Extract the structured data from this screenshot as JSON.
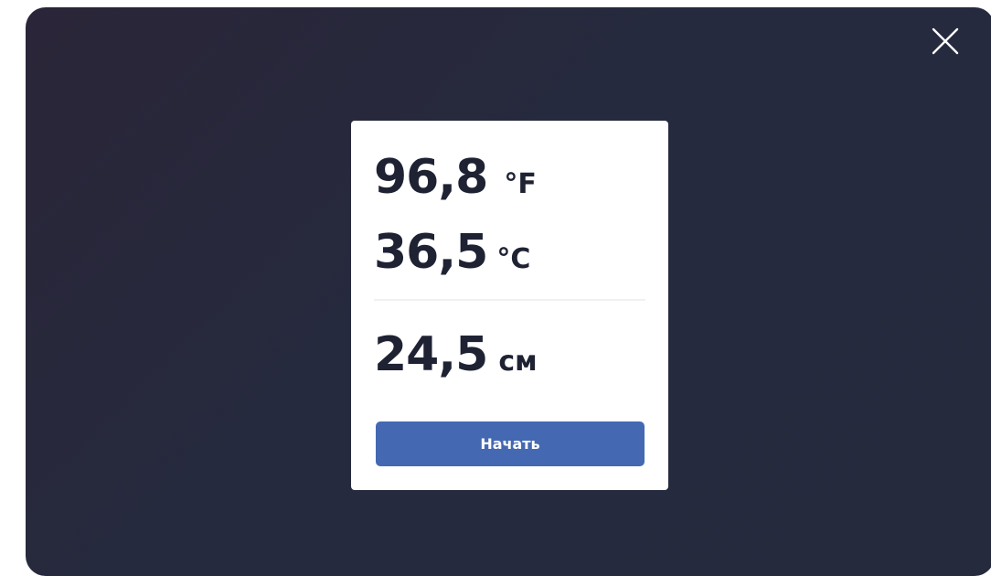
{
  "readings": {
    "fahrenheit": {
      "value": "96,8",
      "unit": "°F"
    },
    "celsius": {
      "value": "36,5",
      "unit": "°C"
    },
    "length": {
      "value": "24,5",
      "unit": "см"
    }
  },
  "actions": {
    "start_label": "Начать"
  },
  "icons": {
    "close": "close-icon"
  },
  "colors": {
    "overlay": "#262a3e",
    "card": "#ffffff",
    "text": "#1e2233",
    "button": "#4469b2",
    "button_text": "#ffffff",
    "close_icon": "#ffffff"
  }
}
